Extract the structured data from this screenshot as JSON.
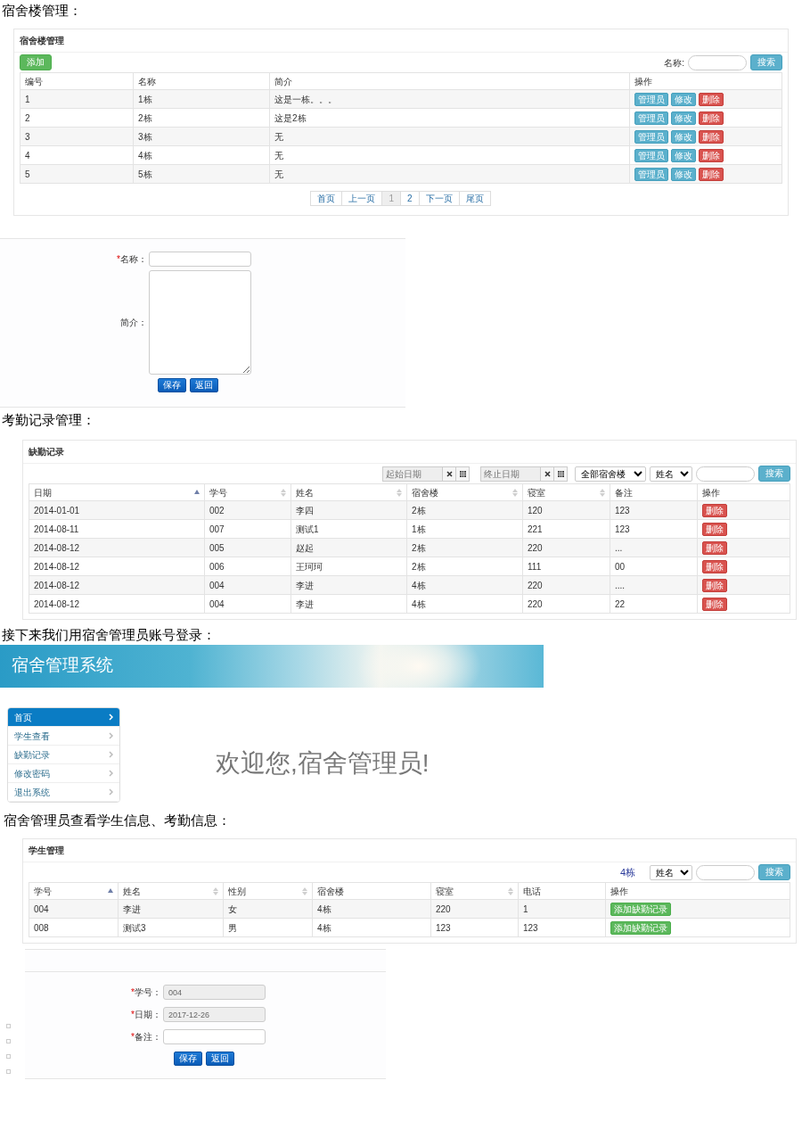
{
  "building_section": {
    "caption": "宿舍楼管理：",
    "panel_title": "宿舍楼管理",
    "add_button": "添加",
    "search_label": "名称:",
    "search_button": "搜索",
    "columns": [
      {
        "label": "编号"
      },
      {
        "label": "名称"
      },
      {
        "label": "简介"
      },
      {
        "label": "操作"
      }
    ],
    "rows": [
      {
        "cells": [
          "1",
          "1栋",
          "这是一栋。。。"
        ],
        "actions": [
          {
            "label": "管理员",
            "kind": "info"
          },
          {
            "label": "修改",
            "kind": "info"
          },
          {
            "label": "删除",
            "kind": "danger"
          }
        ]
      },
      {
        "cells": [
          "2",
          "2栋",
          "这是2栋"
        ],
        "actions": [
          {
            "label": "管理员",
            "kind": "info"
          },
          {
            "label": "修改",
            "kind": "info"
          },
          {
            "label": "删除",
            "kind": "danger"
          }
        ]
      },
      {
        "cells": [
          "3",
          "3栋",
          "无"
        ],
        "actions": [
          {
            "label": "管理员",
            "kind": "info"
          },
          {
            "label": "修改",
            "kind": "info"
          },
          {
            "label": "删除",
            "kind": "danger"
          }
        ]
      },
      {
        "cells": [
          "4",
          "4栋",
          "无"
        ],
        "actions": [
          {
            "label": "管理员",
            "kind": "info"
          },
          {
            "label": "修改",
            "kind": "info"
          },
          {
            "label": "删除",
            "kind": "danger"
          }
        ]
      },
      {
        "cells": [
          "5",
          "5栋",
          "无"
        ],
        "actions": [
          {
            "label": "管理员",
            "kind": "info"
          },
          {
            "label": "修改",
            "kind": "info"
          },
          {
            "label": "删除",
            "kind": "danger"
          }
        ]
      }
    ],
    "pagination": [
      {
        "label": "首页",
        "selected": false
      },
      {
        "label": "上一页",
        "selected": false
      },
      {
        "label": "1",
        "selected": true
      },
      {
        "label": "2",
        "selected": false
      },
      {
        "label": "下一页",
        "selected": false
      },
      {
        "label": "尾页",
        "selected": false
      }
    ]
  },
  "building_form": {
    "fields": [
      {
        "label": "名称：",
        "required_mark": "*",
        "kind": "input"
      },
      {
        "label": "简介：",
        "kind": "textarea"
      }
    ],
    "buttons": [
      "保存",
      "返回"
    ]
  },
  "attendance_section": {
    "caption": "考勤记录管理：",
    "panel_title": "缺勤记录",
    "start_date": {
      "placeholder": "起始日期"
    },
    "end_date": {
      "placeholder": "终止日期"
    },
    "building_select": "全部宿舍楼",
    "field_select": "姓名",
    "search_button": "搜索",
    "columns": [
      {
        "label": "日期",
        "sortable": true,
        "sorted": true
      },
      {
        "label": "学号",
        "sortable": true,
        "sorted": false
      },
      {
        "label": "姓名",
        "sortable": true,
        "sorted": false
      },
      {
        "label": "宿舍楼",
        "sortable": true,
        "sorted": false
      },
      {
        "label": "寝室",
        "sortable": true,
        "sorted": false
      },
      {
        "label": "备注",
        "sortable": false,
        "sorted": false
      },
      {
        "label": "操作",
        "sortable": false,
        "sorted": false
      }
    ],
    "rows": [
      {
        "cells": [
          "2014-01-01",
          "002",
          "李四",
          "2栋",
          "120",
          "123"
        ],
        "action": "删除"
      },
      {
        "cells": [
          "2014-08-11",
          "007",
          "测试1",
          "1栋",
          "221",
          "123"
        ],
        "action": "删除"
      },
      {
        "cells": [
          "2014-08-12",
          "005",
          "赵起",
          "2栋",
          "220",
          "..."
        ],
        "action": "删除"
      },
      {
        "cells": [
          "2014-08-12",
          "006",
          "王珂珂",
          "2栋",
          "111",
          "00"
        ],
        "action": "删除"
      },
      {
        "cells": [
          "2014-08-12",
          "004",
          "李进",
          "4栋",
          "220",
          "...."
        ],
        "action": "删除"
      },
      {
        "cells": [
          "2014-08-12",
          "004",
          "李进",
          "4栋",
          "220",
          "22"
        ],
        "action": "删除"
      }
    ]
  },
  "login_caption": "接下来我们用宿舍管理员账号登录：",
  "admin_app": {
    "banner_title": "宿舍管理系统",
    "menu": [
      {
        "label": "首页",
        "selected": true
      },
      {
        "label": "学生查看",
        "selected": false
      },
      {
        "label": "缺勤记录",
        "selected": false
      },
      {
        "label": "修改密码",
        "selected": false
      },
      {
        "label": "退出系统",
        "selected": false
      }
    ],
    "welcome": "欢迎您,宿舍管理员!"
  },
  "student_section": {
    "caption": "宿舍管理员查看学生信息、考勤信息：",
    "panel_title": "学生管理",
    "building_label": "4栋",
    "field_select": "姓名",
    "search_button": "搜索",
    "columns": [
      {
        "label": "学号",
        "sortable": true,
        "sorted": true
      },
      {
        "label": "姓名",
        "sortable": true,
        "sorted": false
      },
      {
        "label": "性别",
        "sortable": true,
        "sorted": false
      },
      {
        "label": "宿舍楼",
        "sortable": false,
        "sorted": false
      },
      {
        "label": "寝室",
        "sortable": true,
        "sorted": false
      },
      {
        "label": "电话",
        "sortable": false,
        "sorted": false
      },
      {
        "label": "操作",
        "sortable": false,
        "sorted": false
      }
    ],
    "rows": [
      {
        "cells": [
          "004",
          "李进",
          "女",
          "4栋",
          "220",
          "1"
        ],
        "action": "添加缺勤记录"
      },
      {
        "cells": [
          "008",
          "测试3",
          "男",
          "4栋",
          "123",
          "123"
        ],
        "action": "添加缺勤记录"
      }
    ]
  },
  "absence_form": {
    "fields": [
      {
        "label": "学号：",
        "required_mark": "*",
        "value": "004",
        "disabled": true
      },
      {
        "label": "日期：",
        "required_mark": "*",
        "value": "2017-12-26",
        "disabled": true
      },
      {
        "label": "备注：",
        "required_mark": "*",
        "disabled": false
      }
    ],
    "buttons": [
      "保存",
      "返回"
    ]
  }
}
